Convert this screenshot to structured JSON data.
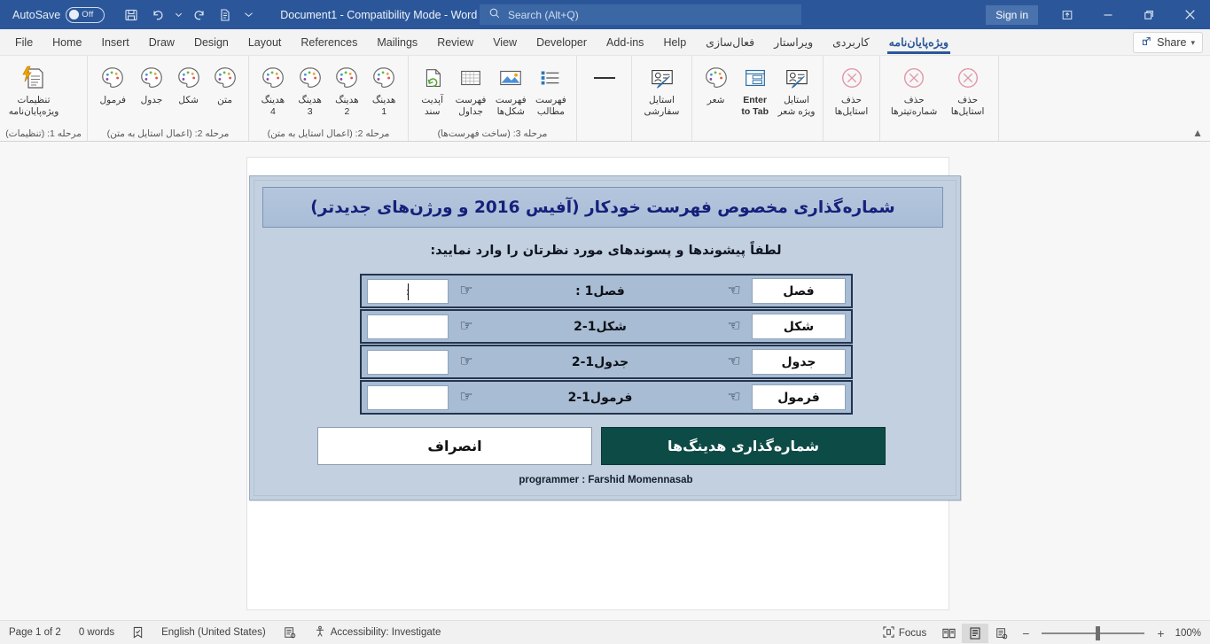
{
  "titlebar": {
    "autosave_label": "AutoSave",
    "autosave_state": "Off",
    "document_title": "Document1  -  Compatibility Mode  -  Word",
    "search_placeholder": "Search (Alt+Q)",
    "signin_label": "Sign in",
    "icons": [
      "save-icon",
      "undo-icon",
      "undo-dropdown-icon",
      "redo-icon",
      "print-preview-icon",
      "customize-quick-access-icon"
    ],
    "window_buttons": [
      "ribbon-display-options",
      "minimize",
      "restore",
      "close"
    ],
    "accent": "#2b579a"
  },
  "tabs": {
    "items": [
      {
        "label": "File",
        "rtl": false,
        "active": false
      },
      {
        "label": "Home",
        "rtl": false,
        "active": false
      },
      {
        "label": "Insert",
        "rtl": false,
        "active": false
      },
      {
        "label": "Draw",
        "rtl": false,
        "active": false
      },
      {
        "label": "Design",
        "rtl": false,
        "active": false
      },
      {
        "label": "Layout",
        "rtl": false,
        "active": false
      },
      {
        "label": "References",
        "rtl": false,
        "active": false
      },
      {
        "label": "Mailings",
        "rtl": false,
        "active": false
      },
      {
        "label": "Review",
        "rtl": false,
        "active": false
      },
      {
        "label": "View",
        "rtl": false,
        "active": false
      },
      {
        "label": "Developer",
        "rtl": false,
        "active": false
      },
      {
        "label": "Add-ins",
        "rtl": false,
        "active": false
      },
      {
        "label": "Help",
        "rtl": false,
        "active": false
      },
      {
        "label": "فعال‌سازی",
        "rtl": true,
        "active": false
      },
      {
        "label": "ویراستار",
        "rtl": true,
        "active": false
      },
      {
        "label": "کاربردی",
        "rtl": true,
        "active": false
      },
      {
        "label": "ویژه‌پایان‌نامه",
        "rtl": true,
        "active": true
      }
    ],
    "share_label": "Share"
  },
  "ribbon": {
    "groups": [
      {
        "label": "مرحله 1: (تنظیمات)",
        "items": [
          {
            "icon": "settings-document-icon",
            "label": "تنظیمات\nویژه‌پایان‌نامه",
            "ltr": false
          }
        ]
      },
      {
        "label": "مرحله 2: (اعمال استایل به متن)",
        "items": [
          {
            "icon": "palette-icon",
            "label": "متن",
            "ltr": false
          },
          {
            "icon": "palette-icon",
            "label": "شکل",
            "ltr": false
          },
          {
            "icon": "palette-icon",
            "label": "جدول",
            "ltr": false
          },
          {
            "icon": "palette-icon",
            "label": "فرمول",
            "ltr": false
          }
        ]
      },
      {
        "label": "مرحله 2: (اعمال استایل به متن)",
        "items": [
          {
            "icon": "palette-icon",
            "label": "هدینگ\n1",
            "ltr": false
          },
          {
            "icon": "palette-icon",
            "label": "هدینگ\n2",
            "ltr": false
          },
          {
            "icon": "palette-icon",
            "label": "هدینگ\n3",
            "ltr": false
          },
          {
            "icon": "palette-icon",
            "label": "هدینگ\n4",
            "ltr": false
          }
        ]
      },
      {
        "label": "مرحله 3: (ساخت فهرست‌ها)",
        "items": [
          {
            "icon": "bullet-list-icon",
            "label": "فهرست\nمطالب",
            "ltr": false
          },
          {
            "icon": "picture-icon",
            "label": "فهرست\nشکل‌ها",
            "ltr": false
          },
          {
            "icon": "table-grid-icon",
            "label": "فهرست\nجداول",
            "ltr": false
          },
          {
            "icon": "refresh-document-icon",
            "label": "آپدیت\nسند",
            "ltr": false
          }
        ]
      },
      {
        "label": "",
        "items": [
          {
            "icon": "dash-icon",
            "label": "",
            "ltr": false
          }
        ]
      },
      {
        "label": "",
        "items": [
          {
            "icon": "style-pen-icon",
            "label": "استایل\nسفارشی",
            "ltr": false
          }
        ]
      },
      {
        "label": "",
        "items": [
          {
            "icon": "style-pen-icon",
            "label": "استایل\nویژه شعر",
            "ltr": false
          },
          {
            "icon": "enter-to-tab-icon",
            "label": "Enter\nto Tab",
            "ltr": true
          },
          {
            "icon": "palette-icon",
            "label": "شعر",
            "ltr": false
          }
        ]
      },
      {
        "label": "",
        "items": [
          {
            "icon": "delete-circle-icon",
            "label": "حذف\nاستایل‌ها",
            "ltr": false
          }
        ]
      },
      {
        "label": "",
        "items": [
          {
            "icon": "delete-circle-icon",
            "label": "حذف\nاستایل‌ها",
            "ltr": false
          },
          {
            "icon": "delete-circle-icon",
            "label": "حذف\nشماره‌تیترها",
            "ltr": false
          }
        ]
      }
    ]
  },
  "dialog": {
    "title": "شماره‌گذاری مخصوص فهرست خودکار (آفیس 2016 و ورژن‌های جدیدتر)",
    "subtitle": "لطفاً پیشوندها و پسوندهای مورد نظرتان را وارد نمایید:",
    "rows": [
      {
        "label": "فصل",
        "example": "فصل1 :",
        "value": "؛",
        "focused": true
      },
      {
        "label": "شکل",
        "example": "شکل1-2",
        "value": "",
        "focused": false
      },
      {
        "label": "جدول",
        "example": "جدول1-2",
        "value": "",
        "focused": false
      },
      {
        "label": "فرمول",
        "example": "فرمول1-2",
        "value": "",
        "focused": false
      }
    ],
    "hand_right_icon": "☜",
    "hand_left_icon": "☞",
    "ok_label": "شماره‌گذاری هدینگ‌ها",
    "cancel_label": "انصراف",
    "credit": "programmer : Farshid  Momennasab",
    "ok_color": "#0d4b46"
  },
  "statusbar": {
    "page": "Page 1 of 2",
    "words": "0 words",
    "proofing_icon": "proofing-icon",
    "language": "English (United States)",
    "track_changes_icon": "track-changes-icon",
    "accessibility": "Accessibility: Investigate",
    "focus_label": "Focus",
    "views": [
      "read-mode-icon",
      "print-layout-icon",
      "web-layout-icon"
    ],
    "zoom_minus": "−",
    "zoom_plus": "+",
    "zoom_value": "100%"
  }
}
